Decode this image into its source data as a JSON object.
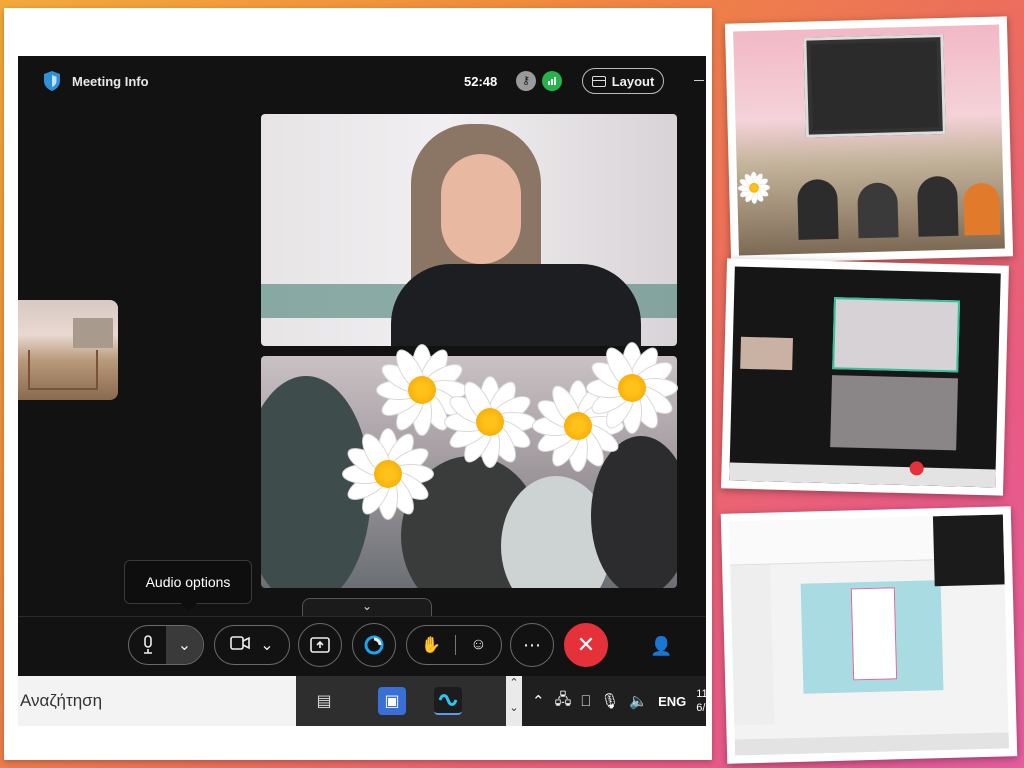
{
  "webex": {
    "title": "Meeting Info",
    "timer": "52:48",
    "layout_label": "Layout",
    "tooltip": "Audio options",
    "expand_glyph": "⌄",
    "colors": {
      "leave": "#e5323a",
      "signal": "#25b34b",
      "background": "#121212"
    },
    "icons": [
      "shield-icon",
      "lock-icon",
      "signal-icon",
      "layout-icon",
      "microphone-icon",
      "chevron-down-icon",
      "camera-icon",
      "share-icon",
      "webex-app-icon",
      "raise-hand-icon",
      "reaction-icon",
      "more-icon",
      "leave-icon",
      "participants-icon"
    ]
  },
  "taskbar": {
    "search_placeholder": "Αναζήτηση",
    "language": "ENG",
    "clock_time": "11",
    "clock_date": "6/"
  }
}
